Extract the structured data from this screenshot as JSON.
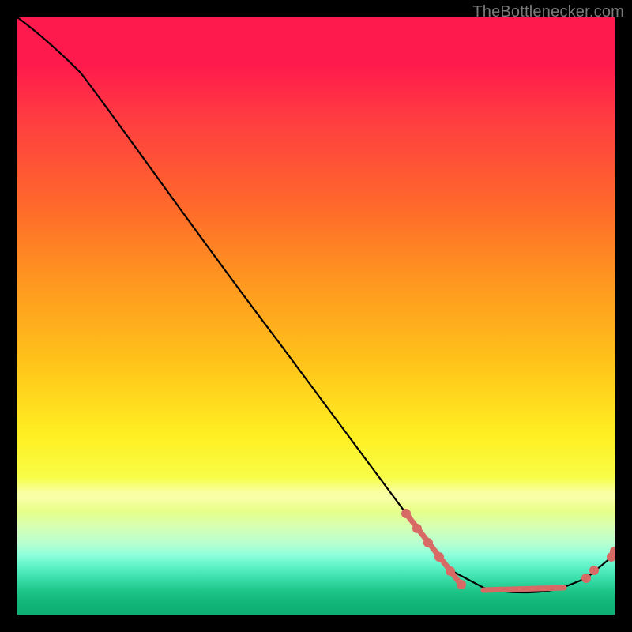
{
  "watermark": "TheBottlenecker.com",
  "chart_data": {
    "type": "line",
    "title": "",
    "xlabel": "",
    "ylabel": "",
    "xlim": [
      0,
      100
    ],
    "ylim": [
      0,
      100
    ],
    "series": [
      {
        "name": "bottleneck-curve",
        "x": [
          0,
          5,
          10,
          20,
          30,
          40,
          50,
          60,
          68,
          72,
          78,
          85,
          90,
          95,
          100
        ],
        "values": [
          100,
          98,
          95,
          83,
          70,
          57,
          44,
          31,
          20,
          14,
          7,
          5,
          5,
          7,
          11
        ]
      }
    ],
    "markers": {
      "name": "highlighted-range",
      "x": [
        68,
        70,
        72,
        74,
        78,
        82,
        85,
        88,
        90,
        94,
        96,
        100
      ],
      "values": [
        20,
        17,
        14,
        11,
        7,
        6,
        5,
        5,
        5,
        6,
        8,
        11
      ]
    },
    "colors": {
      "gradient_top": "#ff1a4d",
      "gradient_mid": "#ffef22",
      "gradient_bottom": "#0fae73",
      "curve": "#000000",
      "marker": "#d86a65",
      "frame": "#000000"
    }
  }
}
